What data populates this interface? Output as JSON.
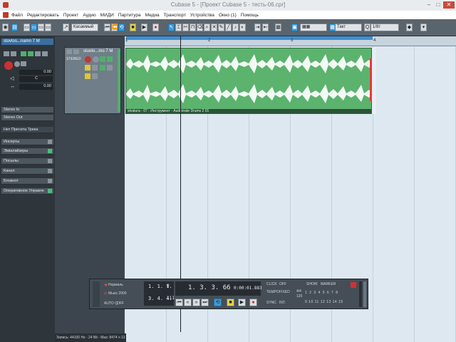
{
  "window": {
    "title": "Cubase 5 - [Проект Cubase 5 - тесть-06.cpr]"
  },
  "menu": [
    "Файл",
    "Редактировать",
    "Проект",
    "Аудио",
    "МИДИ",
    "Партитура",
    "Медиа",
    "Транспорт",
    "Устройства",
    "Окно (1)",
    "Помощь"
  ],
  "toolbar": {
    "quantize_label": "Касаемый",
    "grid_label": "Такт",
    "quantize_value": "1/8т"
  },
  "inspector": {
    "track_name": "stovtos...namn 7 M",
    "volume_value": "0.00",
    "pan_value": "C",
    "send_value": "0.00",
    "routing_in": "Stereo In",
    "routing_out": "Stereo Out",
    "preset": "Нет Пресета Трека",
    "sections": [
      "Инсерты",
      "Эквалайзеры",
      "Посылы",
      "Канал",
      "Блокнот",
      "Оперативное Управле"
    ]
  },
  "track": {
    "name": "stuoto...mo 7 M",
    "stereo": "STEREO"
  },
  "ruler": {
    "marks": [
      "1",
      "2",
      "3",
      "4"
    ]
  },
  "clip": {
    "label": "stvatura - 07 - Инструмент - Audiotrate Drums 2 01"
  },
  "transport": {
    "mode_top": "Нормаль",
    "mode_mid": "Мьюс 2000",
    "auto_label": "AUTO Q",
    "auto_value": "OFF",
    "left_locator": "1. 1. 1.",
    "left_locator_sub": "0",
    "right_locator": "3. 4. 4.",
    "right_locator_sub": "111",
    "position_main": "1. 3. 3. 66",
    "position_time": "0:00:01.883",
    "click_label": "CLICK",
    "click_value": "OFF",
    "tempo_label": "TEMPO",
    "tempo_value": "FIXED",
    "tempo_number": "4/4",
    "tempo_bpm": "120",
    "sync_label": "SYNC",
    "sync_value": "INT.",
    "show_label": "SHOW",
    "marker_label": "MARKER",
    "marker_numbers": [
      "1",
      "2",
      "3",
      "4",
      "5",
      "6",
      "7",
      "8"
    ],
    "marker_numbers2": [
      "9",
      "10",
      "11",
      "12",
      "13",
      "14",
      "15"
    ]
  },
  "status": {
    "text": "Запись: 44100 Hz - 24 Bit - Max: 8474 ч 13 мин"
  }
}
